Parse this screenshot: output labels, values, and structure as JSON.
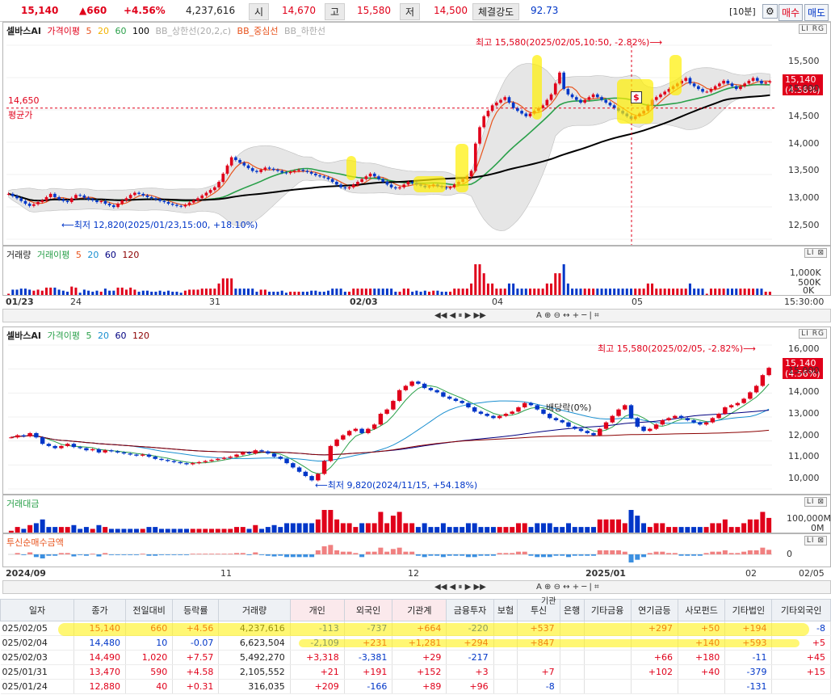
{
  "header": {
    "price": "15,140",
    "change": "▲660",
    "change_pct": "+4.56%",
    "volume": "4,237,616",
    "open_label": "시",
    "open": "14,670",
    "high_label": "고",
    "high": "15,580",
    "low_label": "저",
    "low": "14,500",
    "strength_label": "체결강도",
    "strength": "92.73",
    "period": "[10분]",
    "buy_label": "매수",
    "sell_label": "매도"
  },
  "upper_chart": {
    "legend_name": "셀바스AI",
    "legend_items": [
      "가격이평",
      "5",
      "20",
      "60",
      "100",
      "BB_상한선(20,2,c)",
      "BB_중심선",
      "BB_하한선"
    ],
    "high_note": "최고 15,580(2025/02/05,10:50, -2.82%)⟶",
    "low_note": "⟵최저 12,820(2025/01/23,15:00, +18.10%)",
    "avg_value": "14,650",
    "avg_label": "평균가",
    "price_tag": "15,140",
    "price_tag_pct": "(4.56%)",
    "y_ticks": [
      "15,500",
      "15,000",
      "14,500",
      "14,000",
      "13,500",
      "13,000",
      "12,500"
    ],
    "vol_legend": [
      "거래량",
      "거래이평",
      "5",
      "20",
      "60",
      "120"
    ],
    "vol_ticks": [
      "1,000K",
      "500K",
      "0K"
    ],
    "x_labels": [
      "01/23",
      "24",
      "31",
      "02/03",
      "04",
      "05"
    ],
    "time_label": "15:30:00",
    "controls": "LI RG",
    "marker": "$",
    "chart_data": {
      "type": "candlestick",
      "title": "",
      "ylim": [
        12250,
        15800
      ],
      "closes": [
        13080,
        13040,
        13000,
        12950,
        12900,
        12860,
        12890,
        12930,
        12960,
        13020,
        13080,
        13020,
        12980,
        12950,
        12930,
        13000,
        13060,
        13050,
        13010,
        12980,
        12960,
        12930,
        12950,
        12900,
        12870,
        12840,
        12900,
        12960,
        13000,
        13060,
        13100,
        13080,
        13050,
        13020,
        13000,
        12980,
        12950,
        12930,
        12900,
        12880,
        12860,
        12850,
        12880,
        12920,
        12960,
        13000,
        13050,
        13100,
        13150,
        13200,
        13300,
        13450,
        13600,
        13750,
        13700,
        13650,
        13600,
        13550,
        13500,
        13480,
        13520,
        13560,
        13540,
        13520,
        13500,
        13470,
        13460,
        13480,
        13500,
        13520,
        13500,
        13480,
        13450,
        13420,
        13400,
        13380,
        13350,
        13300,
        13250,
        13200,
        13180,
        13200,
        13250,
        13300,
        13350,
        13400,
        13450,
        13400,
        13350,
        13300,
        13250,
        13200,
        13180,
        13200,
        13250,
        13300,
        13280,
        13250,
        13230,
        13200,
        13220,
        13250,
        13220,
        13200,
        13180,
        13200,
        13250,
        13300,
        13350,
        13400,
        13500,
        14000,
        14300,
        14500,
        14600,
        14700,
        14750,
        14800,
        14850,
        14750,
        14650,
        14600,
        14550,
        14500,
        14550,
        14600,
        14650,
        14700,
        14800,
        14900,
        15100,
        15300,
        15000,
        14900,
        14850,
        14800,
        14750,
        14800,
        14850,
        14900,
        14850,
        14800,
        14750,
        14700,
        14650,
        14600,
        14550,
        14500,
        14450,
        14500,
        14550,
        14600,
        14700,
        14800,
        14850,
        14900,
        14950,
        15000,
        15050,
        15100,
        15150,
        15200,
        15100,
        15050,
        15000,
        14950,
        14950,
        15000,
        15050,
        15100,
        15150,
        15100,
        15050,
        15000,
        15050,
        15100,
        15150,
        15200,
        15150,
        15100,
        15120,
        15140
      ]
    }
  },
  "lower_chart": {
    "legend_name": "셀바스AI",
    "legend_items": [
      "가격이평",
      "5",
      "20",
      "60",
      "120"
    ],
    "high_note": "최고 15,580(2025/02/05, -2.82%)⟶",
    "low_note": "⟵최저 9,820(2024/11/15, +54.18%)",
    "dividend_note": "배당락(0%)",
    "price_tag": "15,140",
    "price_tag_pct": "(4.56%)",
    "y_ticks": [
      "16,000",
      "15,000",
      "14,000",
      "13,000",
      "12,000",
      "11,000",
      "10,000"
    ],
    "amount_label": "거래대금",
    "amount_ticks": [
      "100,000M",
      "0M"
    ],
    "trust_label": "투신순매수금액",
    "trust_ticks": [
      "0"
    ],
    "x_labels": [
      "2024/09",
      "11",
      "12",
      "2025/01",
      "02"
    ],
    "date_label": "02/05",
    "controls": "LI RG",
    "chart_data": {
      "type": "candlestick",
      "title": "",
      "ylim": [
        9500,
        16200
      ],
      "closes": [
        11900,
        12000,
        11950,
        12100,
        11900,
        11600,
        11500,
        11400,
        11500,
        11600,
        11450,
        11400,
        11300,
        11350,
        11200,
        11300,
        11250,
        11200,
        11150,
        11100,
        11050,
        11100,
        11000,
        10900,
        10850,
        10800,
        10750,
        10700,
        10650,
        10700,
        10750,
        10800,
        10850,
        10900,
        10950,
        11000,
        11100,
        11200,
        11150,
        11300,
        11250,
        11150,
        11000,
        10900,
        10700,
        10500,
        10300,
        10100,
        9900,
        10200,
        10800,
        11500,
        11800,
        12000,
        12200,
        12300,
        12100,
        12300,
        12500,
        13000,
        13200,
        13600,
        14100,
        14300,
        14500,
        14400,
        14200,
        14100,
        14000,
        13800,
        13700,
        13600,
        13500,
        13300,
        13100,
        13000,
        12900,
        12800,
        12900,
        13000,
        13100,
        13300,
        13500,
        13400,
        13200,
        13000,
        12800,
        12700,
        12600,
        12400,
        12300,
        12200,
        12100,
        12000,
        12300,
        12600,
        12900,
        13200,
        13400,
        12800,
        12400,
        12200,
        12300,
        12500,
        12700,
        12800,
        12900,
        12800,
        12700,
        12600,
        12500,
        12600,
        12800,
        13000,
        13300,
        13400,
        13500,
        13700,
        14000,
        14300,
        14800,
        15140
      ]
    }
  },
  "strip": {
    "icons": "◀◀ ◀ ⏸ ▶ ▶▶",
    "tools": "A ⊕ ⊖ ↔ + ─ | ⌗"
  },
  "table": {
    "group_label": "기관",
    "headers": [
      "일자",
      "종가",
      "전일대비",
      "등락률",
      "거래량",
      "개인",
      "외국인",
      "기관계",
      "금융투자",
      "보험",
      "투신",
      "은행",
      "기타금융",
      "연기금등",
      "사모펀드",
      "기타법인",
      "기타외국인"
    ],
    "rows": [
      [
        "025/02/05",
        "15,140",
        "660",
        "+4.56",
        "4,237,616",
        "-113",
        "-737",
        "+664",
        "-220",
        "",
        "+537",
        "",
        "",
        "+297",
        "+50",
        "+194",
        "-8"
      ],
      [
        "025/02/04",
        "14,480",
        "10",
        "-0.07",
        "6,623,504",
        "-2,109",
        "+231",
        "+1,281",
        "+294",
        "",
        "+847",
        "",
        "",
        "",
        "+140",
        "+593",
        "+5"
      ],
      [
        "025/02/03",
        "14,490",
        "1,020",
        "+7.57",
        "5,492,270",
        "+3,318",
        "-3,381",
        "+29",
        "-217",
        "",
        "",
        "",
        "",
        "+66",
        "+180",
        "-11",
        "+45"
      ],
      [
        "025/01/31",
        "13,470",
        "590",
        "+4.58",
        "2,105,552",
        "+21",
        "+191",
        "+152",
        "+3",
        "",
        "+7",
        "",
        "",
        "+102",
        "+40",
        "-379",
        "+15"
      ],
      [
        "025/01/24",
        "12,880",
        "40",
        "+0.31",
        "316,035",
        "+209",
        "-166",
        "+89",
        "+96",
        "",
        "-8",
        "",
        "",
        "",
        "",
        "-131",
        ""
      ]
    ]
  },
  "colors": {
    "up": "#e0001a",
    "down": "#0036c8",
    "ma5": "#e8531c",
    "ma20": "#f2b300",
    "ma60": "#2aa04a",
    "ma100": "#000000",
    "highlight": "#fff000"
  }
}
